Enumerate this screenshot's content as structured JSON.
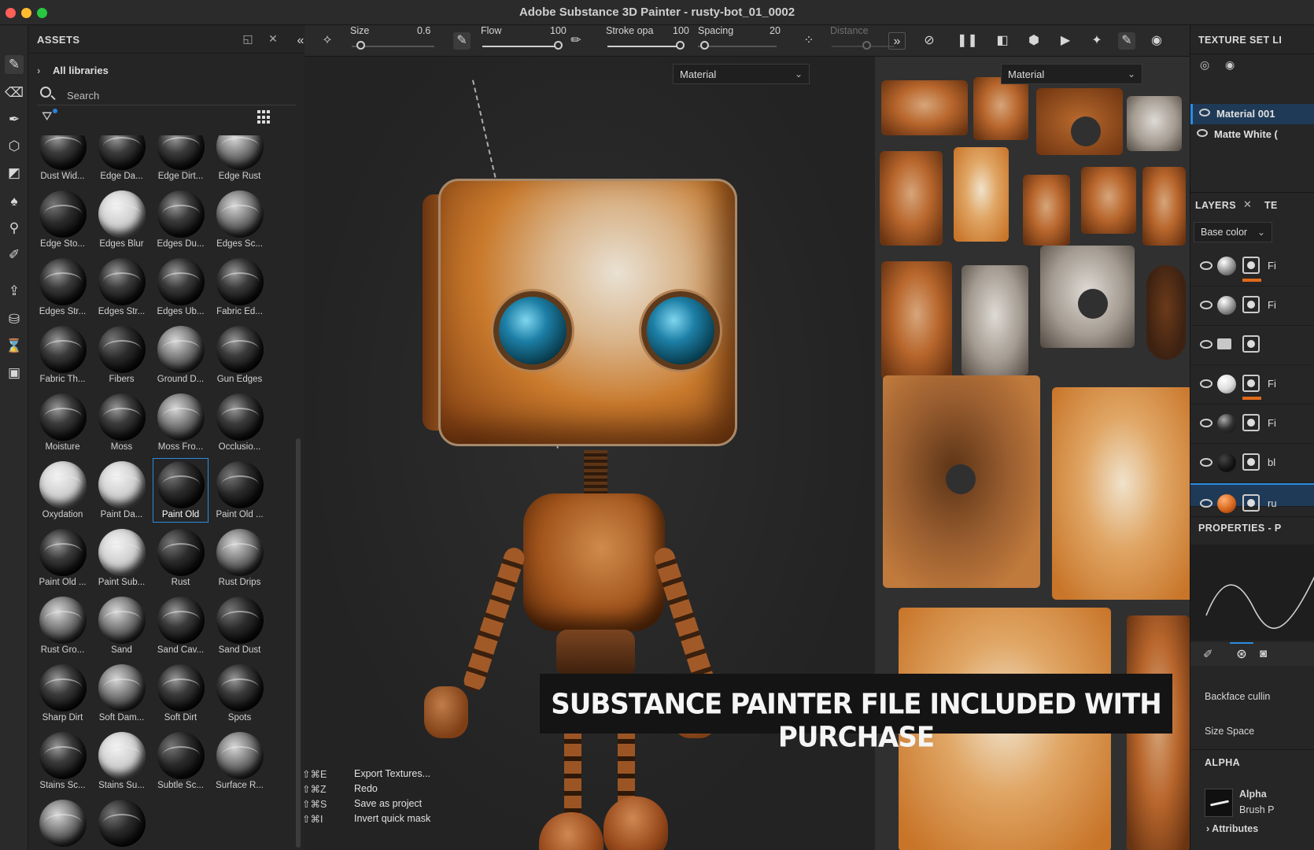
{
  "window": {
    "title": "Adobe Substance 3D Painter - rusty-bot_01_0002"
  },
  "assets": {
    "title": "ASSETS",
    "library": "All libraries",
    "search_placeholder": "Search",
    "items": [
      {
        "label": "Dust Wid...",
        "tone": "dark"
      },
      {
        "label": "Edge Da...",
        "tone": "dark"
      },
      {
        "label": "Edge Dirt...",
        "tone": "dark"
      },
      {
        "label": "Edge Rust",
        "tone": "mid"
      },
      {
        "label": "Edge Sto...",
        "tone": "noisy"
      },
      {
        "label": "Edges Blur",
        "tone": "light"
      },
      {
        "label": "Edges Du...",
        "tone": "dark"
      },
      {
        "label": "Edges Sc...",
        "tone": "mid"
      },
      {
        "label": "Edges Str...",
        "tone": "dark"
      },
      {
        "label": "Edges Str...",
        "tone": "dark"
      },
      {
        "label": "Edges Ub...",
        "tone": "dark"
      },
      {
        "label": "Fabric Ed...",
        "tone": "dark"
      },
      {
        "label": "Fabric Th...",
        "tone": "dark"
      },
      {
        "label": "Fibers",
        "tone": "noisy"
      },
      {
        "label": "Ground D...",
        "tone": "mid"
      },
      {
        "label": "Gun Edges",
        "tone": "dark"
      },
      {
        "label": "Moisture",
        "tone": "dark"
      },
      {
        "label": "Moss",
        "tone": "dark"
      },
      {
        "label": "Moss Fro...",
        "tone": "mid"
      },
      {
        "label": "Occlusio...",
        "tone": "dark"
      },
      {
        "label": "Oxydation",
        "tone": "light"
      },
      {
        "label": "Paint Da...",
        "tone": "light"
      },
      {
        "label": "Paint Old",
        "tone": "noisy",
        "selected": true
      },
      {
        "label": "Paint Old ...",
        "tone": "noisy"
      },
      {
        "label": "Paint Old ...",
        "tone": "dark"
      },
      {
        "label": "Paint Sub...",
        "tone": "light"
      },
      {
        "label": "Rust",
        "tone": "noisy"
      },
      {
        "label": "Rust Drips",
        "tone": "mid"
      },
      {
        "label": "Rust Gro...",
        "tone": "mid"
      },
      {
        "label": "Sand",
        "tone": "mid"
      },
      {
        "label": "Sand Cav...",
        "tone": "dark"
      },
      {
        "label": "Sand Dust",
        "tone": "noisy"
      },
      {
        "label": "Sharp Dirt",
        "tone": "dark"
      },
      {
        "label": "Soft Dam...",
        "tone": "mid"
      },
      {
        "label": "Soft Dirt",
        "tone": "dark"
      },
      {
        "label": "Spots",
        "tone": "dark"
      },
      {
        "label": "Stains Sc...",
        "tone": "dark"
      },
      {
        "label": "Stains Su...",
        "tone": "light"
      },
      {
        "label": "Subtle Sc...",
        "tone": "noisy"
      },
      {
        "label": "Surface R...",
        "tone": "mid"
      },
      {
        "label": "",
        "tone": "mid"
      },
      {
        "label": "",
        "tone": "noisy"
      }
    ]
  },
  "brush_toolbar": {
    "size_label": "Size",
    "size_value": "0.6",
    "flow_label": "Flow",
    "flow_value": "100",
    "stroke_label": "Stroke opa",
    "stroke_value": "100",
    "spacing_label": "Spacing",
    "spacing_value": "20",
    "distance_label": "Distance"
  },
  "viewports": {
    "view3d_mode": "Material",
    "view2d_mode": "Material"
  },
  "banner": {
    "text": "SUBSTANCE PAINTER FILE INCLUDED WITH PURCHASE"
  },
  "shortcuts": [
    {
      "keys": "⇧⌘E",
      "command": "Export Textures..."
    },
    {
      "keys": "⇧⌘Z",
      "command": "Redo"
    },
    {
      "keys": "⇧⌘S",
      "command": "Save as project"
    },
    {
      "keys": "⇧⌘I",
      "command": "Invert quick mask"
    }
  ],
  "texture_set": {
    "title": "TEXTURE SET LI",
    "items": [
      {
        "label": "Material 001",
        "selected": true
      },
      {
        "label": "Matte White (",
        "selected": false
      }
    ]
  },
  "layers": {
    "title": "LAYERS",
    "second_tab": "TE",
    "channel": "Base color",
    "rows": [
      {
        "name": "Fi",
        "ball": "grey",
        "bar": true
      },
      {
        "name": "Fi",
        "ball": "grey",
        "bar": false
      },
      {
        "name": "",
        "ball": "folder",
        "bar": false
      },
      {
        "name": "Fi",
        "ball": "white",
        "bar": true
      },
      {
        "name": "Fi",
        "ball": "dark",
        "bar": false
      },
      {
        "name": "bl",
        "ball": "black",
        "bar": false
      },
      {
        "name": "ru",
        "ball": "orange",
        "bar": false
      }
    ]
  },
  "properties": {
    "title": "PROPERTIES - P",
    "backface_label": "Backface cullin",
    "size_space_label": "Size Space",
    "alpha_title": "ALPHA",
    "alpha_name": "Alpha",
    "alpha_sub": "Brush P",
    "attributes_label": "Attributes"
  }
}
